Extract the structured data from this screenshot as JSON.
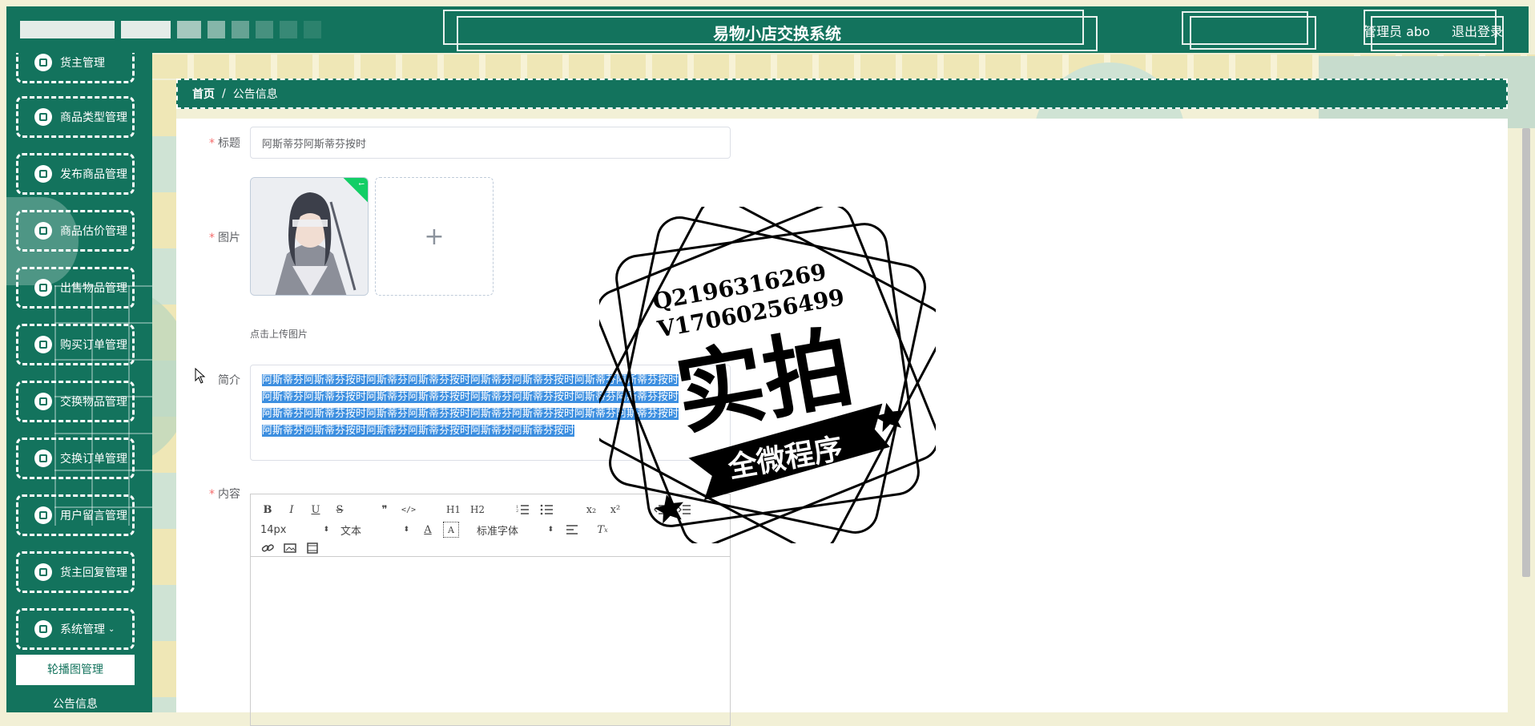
{
  "header": {
    "app_title": "易物小店交换系统",
    "user_label": "管理员 abo",
    "logout_label": "退出登录"
  },
  "sidebar": {
    "partial_top_label": "货主管理",
    "items": [
      {
        "label": "商品类型管理",
        "icon": "tag-icon"
      },
      {
        "label": "发布商品管理",
        "icon": "chart-icon"
      },
      {
        "label": "商品估价管理",
        "icon": "bag-icon"
      },
      {
        "label": "出售物品管理",
        "icon": "flag-icon"
      },
      {
        "label": "购买订单管理",
        "icon": "grid-icon"
      },
      {
        "label": "交换物品管理",
        "icon": "grid-icon"
      },
      {
        "label": "交换订单管理",
        "icon": "card-icon"
      },
      {
        "label": "用户留言管理",
        "icon": "grid-icon"
      },
      {
        "label": "货主回复管理",
        "icon": "grid-icon"
      },
      {
        "label": "系统管理",
        "icon": "gear-icon"
      }
    ],
    "sub_items": [
      "轮播图管理",
      "公告信息"
    ]
  },
  "breadcrumb": {
    "home": "首页",
    "separator": "/",
    "current": "公告信息"
  },
  "form": {
    "title_label": "标题",
    "title_value": "阿斯蒂芬阿斯蒂芬按时",
    "image_label": "图片",
    "upload_tip": "点击上传图片",
    "intro_label": "简介",
    "intro_lines": [
      "阿斯蒂芬阿斯蒂芬按时阿斯蒂芬阿斯蒂芬按时阿斯蒂芬阿斯蒂芬按时阿斯蒂芬阿斯蒂芬按时",
      "阿斯蒂芬阿斯蒂芬按时阿斯蒂芬阿斯蒂芬按时阿斯蒂芬阿斯蒂芬按时阿斯蒂芬阿斯蒂芬按时",
      "阿斯蒂芬阿斯蒂芬按时阿斯蒂芬阿斯蒂芬按时阿斯蒂芬阿斯蒂芬按时阿斯蒂芬阿斯蒂芬按时",
      "阿斯蒂芬阿斯蒂芬按时阿斯蒂芬阿斯蒂芬按时阿斯蒂芬阿斯蒂芬按时"
    ],
    "content_label": "内容"
  },
  "editor": {
    "font_size": "14px",
    "block_type": "文本",
    "font_family": "标准字体",
    "row1": [
      "B",
      "I",
      "U",
      "S",
      "❞",
      "</>",
      "H1",
      "H2",
      "list-ol",
      "list-ul",
      "x₂",
      "x²",
      "outdent",
      "indent"
    ],
    "row3": [
      "link-icon",
      "image-icon",
      "video-icon"
    ]
  },
  "watermark": {
    "line1": "Q2196316269",
    "line2": "V17060256499",
    "big": "实拍",
    "banner": "全微程序"
  },
  "colors": {
    "primary": "#13735d",
    "required": "#f56c6c",
    "selection": "#3d8fe0"
  }
}
